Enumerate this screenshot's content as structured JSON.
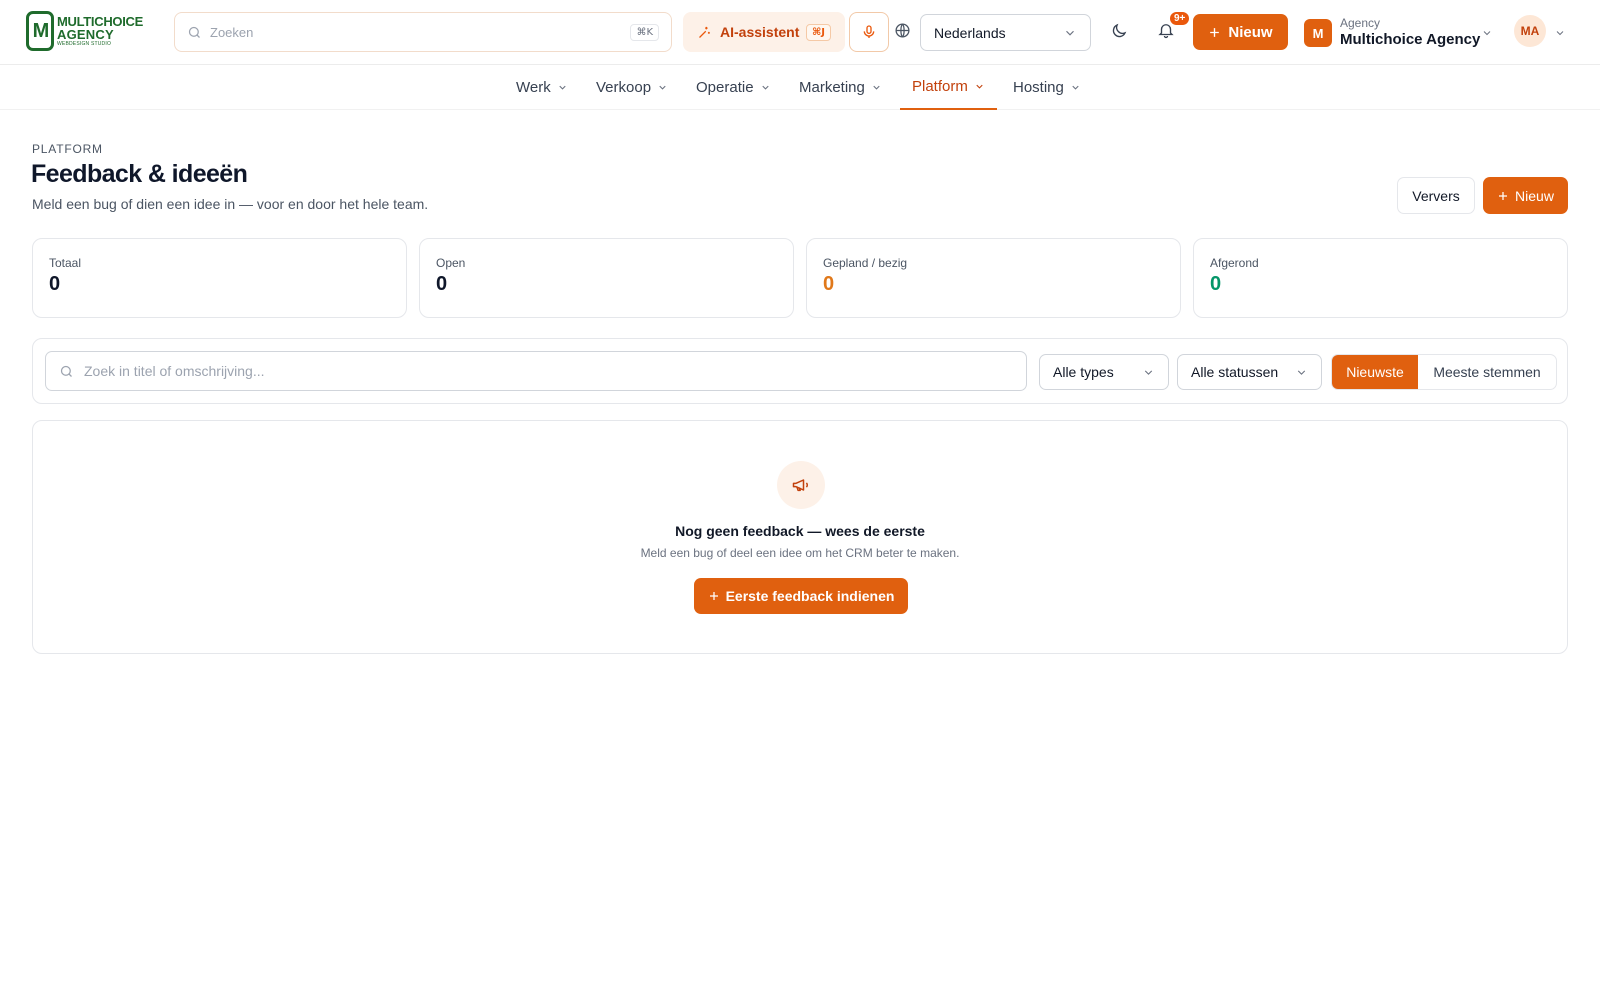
{
  "brand": {
    "logo_mark": "M",
    "name_line1": "MULTICHOICE",
    "name_line2": "AGENCY",
    "tagline": "WEBDESIGN STUDIO"
  },
  "topbar": {
    "search_placeholder": "Zoeken",
    "search_shortcut": "⌘K",
    "ai_label": "AI-assistent",
    "ai_shortcut": "⌘J",
    "language": "Nederlands",
    "notification_badge": "9+",
    "new_label": "Nieuw",
    "agency_initial": "M",
    "agency_caption": "Agency",
    "agency_name": "Multichoice Agency",
    "user_initials": "MA"
  },
  "nav": {
    "items": [
      {
        "label": "Werk"
      },
      {
        "label": "Verkoop"
      },
      {
        "label": "Operatie"
      },
      {
        "label": "Marketing"
      },
      {
        "label": "Platform",
        "active": true
      },
      {
        "label": "Hosting"
      }
    ]
  },
  "header": {
    "eyebrow": "PLATFORM",
    "title": "Feedback & ideeën",
    "subtitle": "Meld een bug of dien een idee in — voor en door het hele team.",
    "refresh_label": "Ververs",
    "new_label": "Nieuw"
  },
  "stats": [
    {
      "label": "Totaal",
      "value": "0",
      "color": "#0f172a"
    },
    {
      "label": "Open",
      "value": "0",
      "color": "#0f172a"
    },
    {
      "label": "Gepland / bezig",
      "value": "0",
      "color": "#e0781a"
    },
    {
      "label": "Afgerond",
      "value": "0",
      "color": "#059669"
    }
  ],
  "filters": {
    "search_placeholder": "Zoek in titel of omschrijving...",
    "type_select": "Alle types",
    "status_select": "Alle statussen",
    "sort_options": [
      "Nieuwste",
      "Meeste stemmen"
    ],
    "sort_active": "Nieuwste"
  },
  "empty_state": {
    "icon": "megaphone-icon",
    "title": "Nog geen feedback — wees de eerste",
    "subtitle": "Meld een bug of deel een idee om het CRM beter te maken.",
    "button_label": "Eerste feedback indienen"
  },
  "colors": {
    "accent": "#e0600f",
    "brand_green": "#1f6b2c"
  }
}
